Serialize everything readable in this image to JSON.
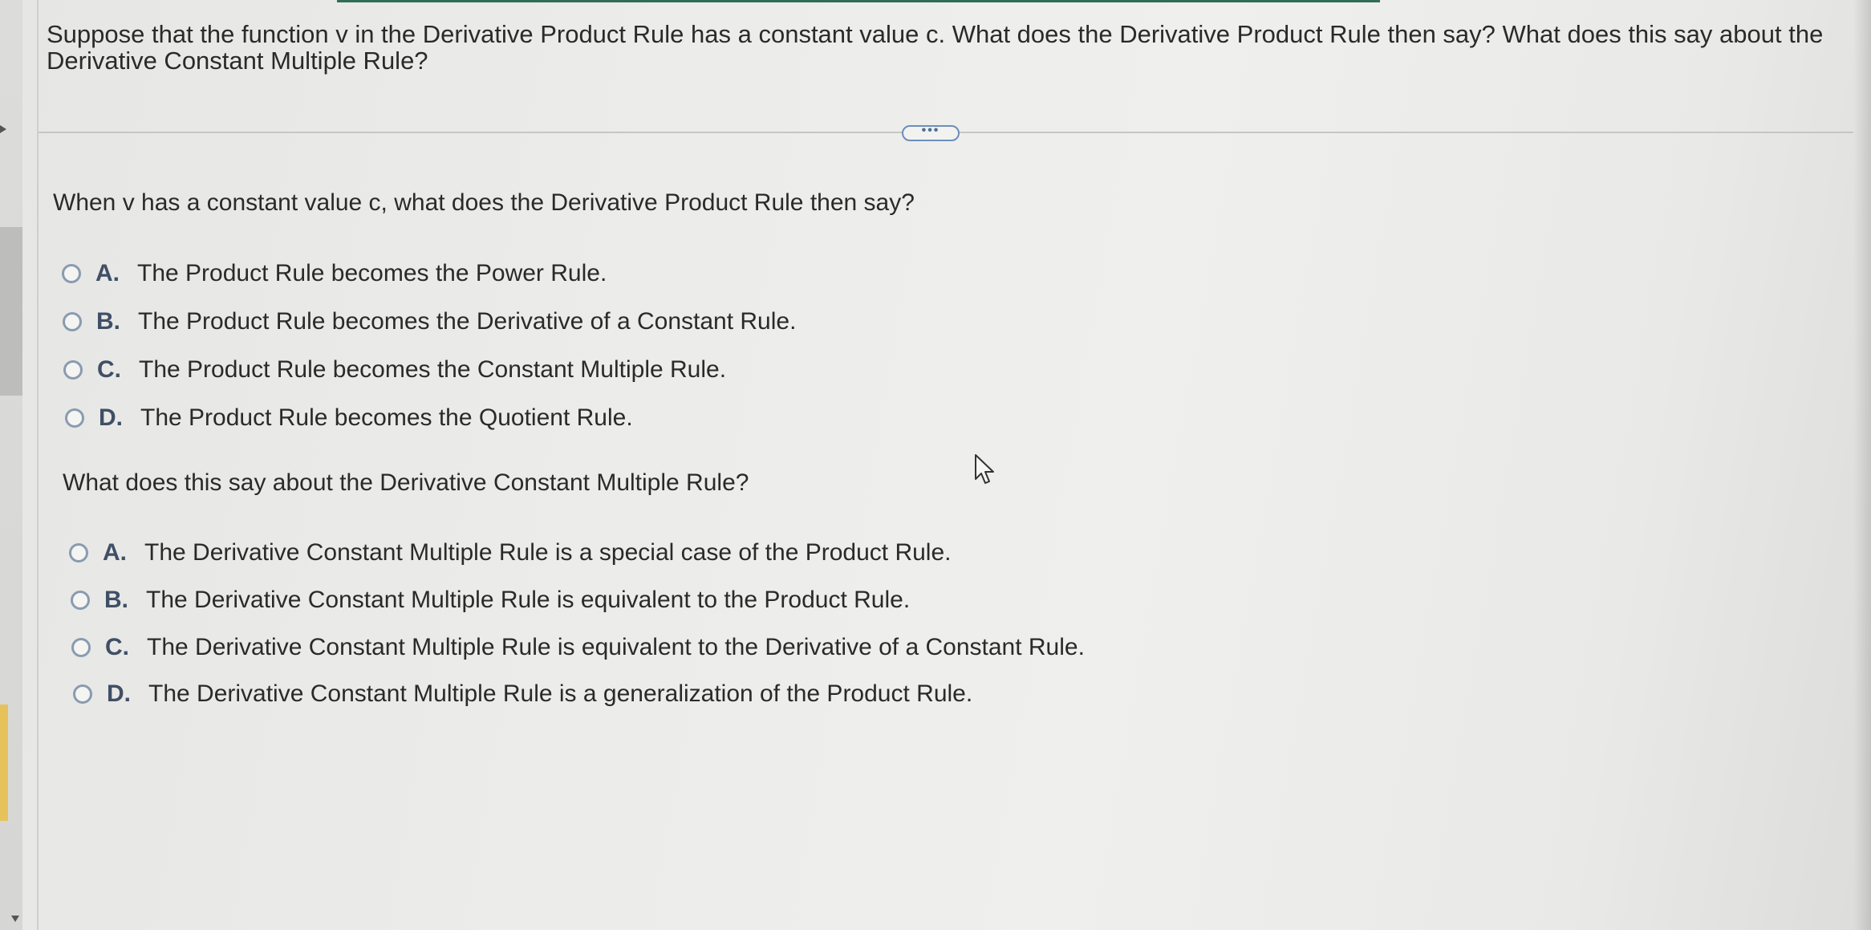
{
  "question": {
    "text": "Suppose that the function v in the Derivative Product Rule has a constant value c. What does the Derivative Product Rule then say? What does this say about the Derivative Constant Multiple Rule?"
  },
  "more_button": {
    "label": "•••"
  },
  "part1": {
    "prompt": "When v has a constant value c, what does the Derivative Product Rule then say?",
    "options": [
      {
        "letter": "A.",
        "text": "The Product Rule becomes the Power Rule."
      },
      {
        "letter": "B.",
        "text": "The Product Rule becomes the Derivative of a Constant Rule."
      },
      {
        "letter": "C.",
        "text": "The Product Rule becomes the Constant Multiple Rule."
      },
      {
        "letter": "D.",
        "text": "The Product Rule becomes the Quotient Rule."
      }
    ]
  },
  "part2": {
    "prompt": "What does this say about the Derivative Constant Multiple Rule?",
    "options": [
      {
        "letter": "A.",
        "text": "The Derivative Constant Multiple Rule is a special case of the Product Rule."
      },
      {
        "letter": "B.",
        "text": "The Derivative Constant Multiple Rule is equivalent to the Product Rule."
      },
      {
        "letter": "C.",
        "text": "The Derivative Constant Multiple Rule is equivalent to the Derivative of a Constant Rule."
      },
      {
        "letter": "D.",
        "text": "The Derivative Constant Multiple Rule is a generalization of the Product Rule."
      }
    ]
  },
  "icons": {
    "cursor": "mouse-pointer-icon"
  },
  "colors": {
    "accent": "#2f6d57",
    "radio_border": "#8a9bb0",
    "option_letter": "#3f4f66",
    "more_button_border": "#6b8fb8"
  }
}
